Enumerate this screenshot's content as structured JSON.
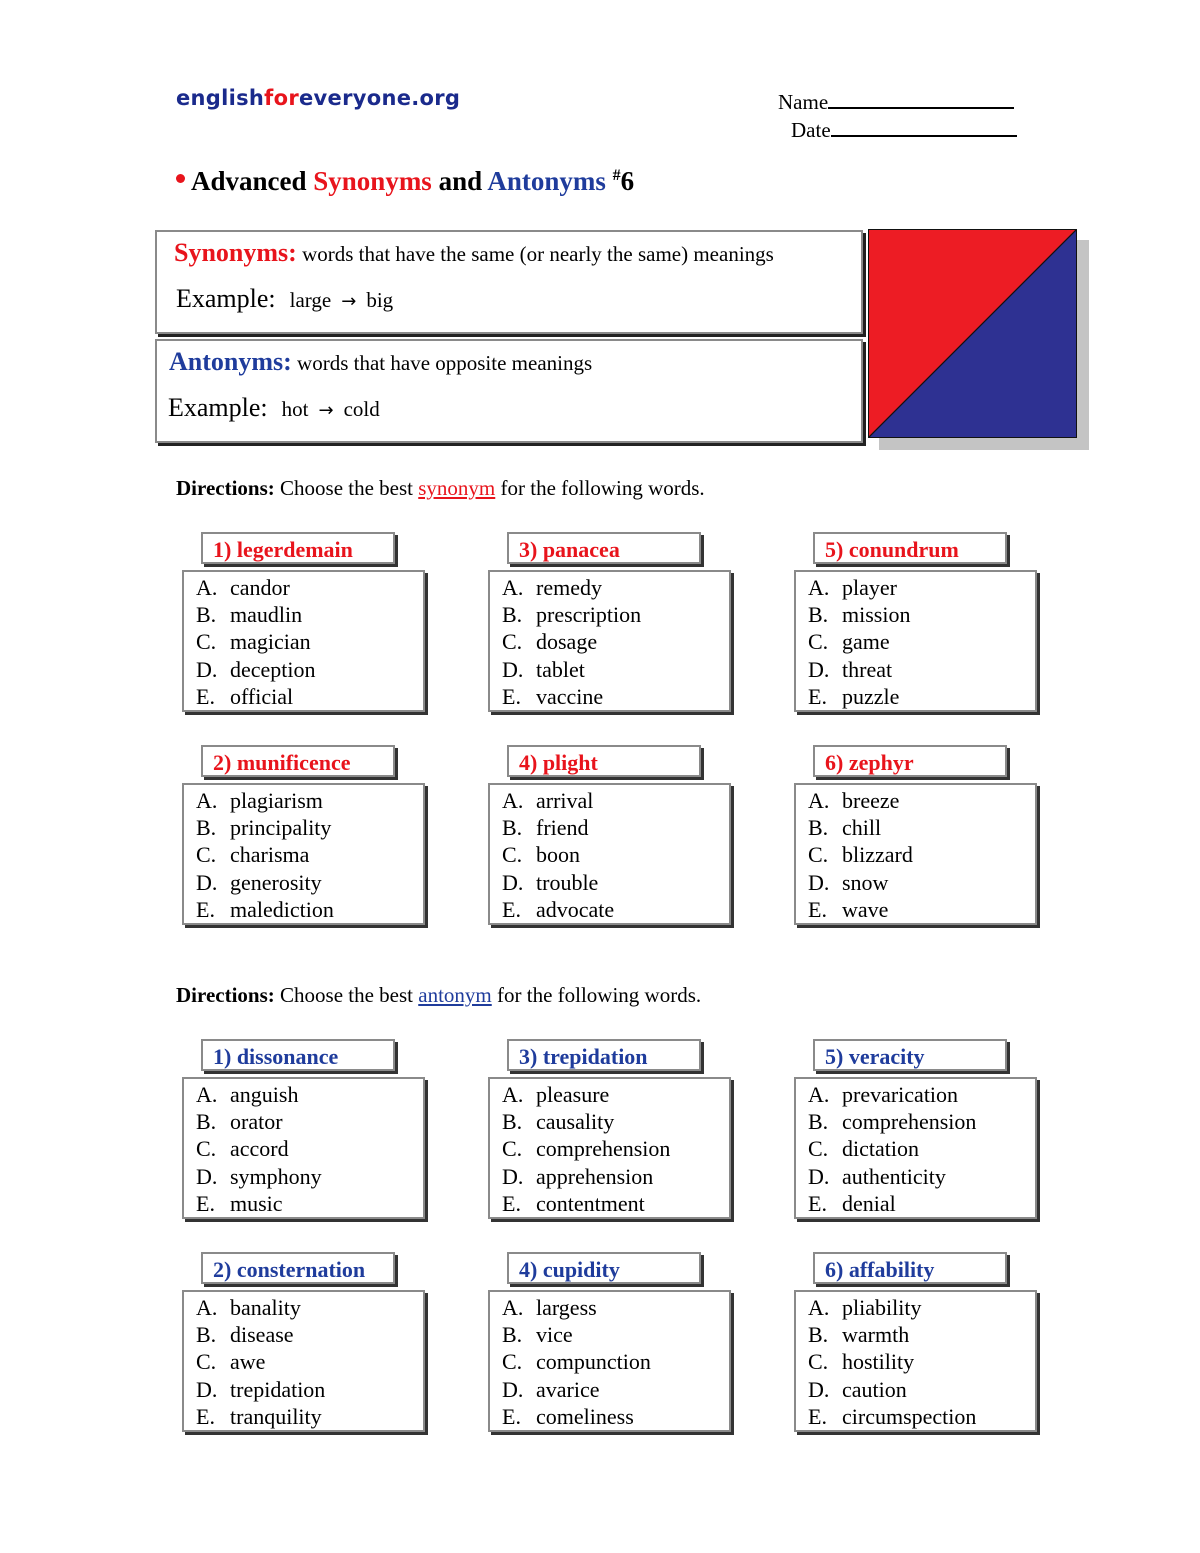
{
  "header": {
    "site_prefix": "english",
    "site_for": "for",
    "site_suffix": "everyone.org",
    "name_label": "Name",
    "date_label": "Date"
  },
  "title": {
    "word1": "Advanced",
    "word2": "Synonyms",
    "word3": "and",
    "word4": "Antonyms",
    "hash": "#",
    "number": "6"
  },
  "definitions": {
    "synonyms": {
      "label": "Synonyms:",
      "text": "words that have the same (or nearly the same) meanings",
      "example_label": "Example:",
      "example_from": "large",
      "arrow": "→",
      "example_to": "big"
    },
    "antonyms": {
      "label": "Antonyms:",
      "text": "words that have opposite meanings",
      "example_label": "Example:",
      "example_from": "hot",
      "arrow": "→",
      "example_to": "cold"
    }
  },
  "colors": {
    "red": "#e8141c",
    "blue": "#1f3c9c",
    "square_red": "#ed1c24",
    "square_blue": "#2e3192"
  },
  "synonym_section": {
    "directions_bold": "Directions:",
    "directions_pre": "Choose the best",
    "directions_keyword": "synonym",
    "directions_post": "for the following words.",
    "questions": [
      {
        "label": "1) legerdemain",
        "options": [
          [
            "A.",
            "candor"
          ],
          [
            "B.",
            "maudlin"
          ],
          [
            "C.",
            "magician"
          ],
          [
            "D.",
            "deception"
          ],
          [
            "E.",
            "official"
          ]
        ]
      },
      {
        "label": "2) munificence",
        "options": [
          [
            "A.",
            "plagiarism"
          ],
          [
            "B.",
            "principality"
          ],
          [
            "C.",
            "charisma"
          ],
          [
            "D.",
            "generosity"
          ],
          [
            "E.",
            "malediction"
          ]
        ]
      },
      {
        "label": "3) panacea",
        "options": [
          [
            "A.",
            "remedy"
          ],
          [
            "B.",
            "prescription"
          ],
          [
            "C.",
            "dosage"
          ],
          [
            "D.",
            "tablet"
          ],
          [
            "E.",
            "vaccine"
          ]
        ]
      },
      {
        "label": "4) plight",
        "options": [
          [
            "A.",
            "arrival"
          ],
          [
            "B.",
            "friend"
          ],
          [
            "C.",
            "boon"
          ],
          [
            "D.",
            "trouble"
          ],
          [
            "E.",
            "advocate"
          ]
        ]
      },
      {
        "label": "5) conundrum",
        "options": [
          [
            "A.",
            "player"
          ],
          [
            "B.",
            "mission"
          ],
          [
            "C.",
            "game"
          ],
          [
            "D.",
            "threat"
          ],
          [
            "E.",
            "puzzle"
          ]
        ]
      },
      {
        "label": "6) zephyr",
        "options": [
          [
            "A.",
            "breeze"
          ],
          [
            "B.",
            "chill"
          ],
          [
            "C.",
            "blizzard"
          ],
          [
            "D.",
            "snow"
          ],
          [
            "E.",
            "wave"
          ]
        ]
      }
    ]
  },
  "antonym_section": {
    "directions_bold": "Directions:",
    "directions_pre": "Choose the best",
    "directions_keyword": "antonym",
    "directions_post": "for the following words.",
    "questions": [
      {
        "label": "1) dissonance",
        "options": [
          [
            "A.",
            "anguish"
          ],
          [
            "B.",
            "orator"
          ],
          [
            "C.",
            "accord"
          ],
          [
            "D.",
            "symphony"
          ],
          [
            "E.",
            "music"
          ]
        ]
      },
      {
        "label": "2) consternation",
        "options": [
          [
            "A.",
            "banality"
          ],
          [
            "B.",
            "disease"
          ],
          [
            "C.",
            "awe"
          ],
          [
            "D.",
            "trepidation"
          ],
          [
            "E.",
            "tranquility"
          ]
        ]
      },
      {
        "label": "3) trepidation",
        "options": [
          [
            "A.",
            "pleasure"
          ],
          [
            "B.",
            "causality"
          ],
          [
            "C.",
            "comprehension"
          ],
          [
            "D.",
            "apprehension"
          ],
          [
            "E.",
            "contentment"
          ]
        ]
      },
      {
        "label": "4) cupidity",
        "options": [
          [
            "A.",
            "largess"
          ],
          [
            "B.",
            "vice"
          ],
          [
            "C.",
            "compunction"
          ],
          [
            "D.",
            "avarice"
          ],
          [
            "E.",
            "comeliness"
          ]
        ]
      },
      {
        "label": "5) veracity",
        "options": [
          [
            "A.",
            "prevarication"
          ],
          [
            "B.",
            "comprehension"
          ],
          [
            "C.",
            "dictation"
          ],
          [
            "D.",
            "authenticity"
          ],
          [
            "E.",
            "denial"
          ]
        ]
      },
      {
        "label": "6) affability",
        "options": [
          [
            "A.",
            "pliability"
          ],
          [
            "B.",
            "warmth"
          ],
          [
            "C.",
            "hostility"
          ],
          [
            "D.",
            "caution"
          ],
          [
            "E.",
            "circumspection"
          ]
        ]
      }
    ]
  }
}
